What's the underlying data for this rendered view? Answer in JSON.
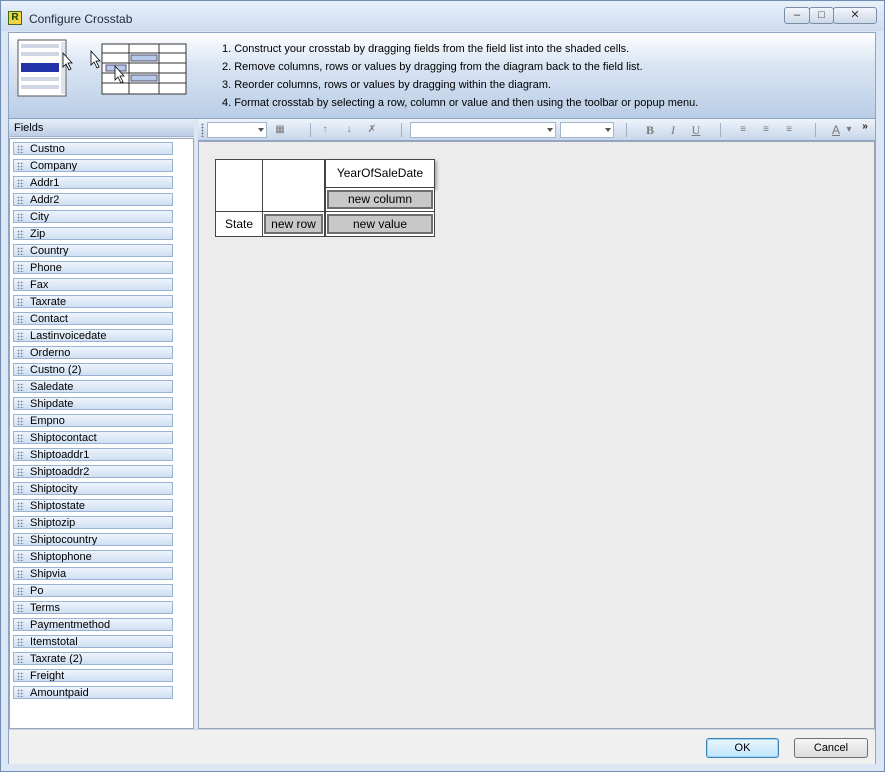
{
  "window": {
    "title": "Configure Crosstab",
    "app_icon_letter": "R"
  },
  "instructions": [
    "1. Construct your crosstab by dragging fields from the field list into the shaded cells.",
    "2. Remove columns, rows or values by dragging from the diagram back to the field list.",
    "3. Reorder columns, rows or values by dragging within the diagram.",
    "4. Format crosstab by selecting a row, column or value and then using the toolbar or popup menu."
  ],
  "fields_panel": {
    "title": "Fields",
    "items": [
      "Custno",
      "Company",
      "Addr1",
      "Addr2",
      "City",
      "Zip",
      "Country",
      "Phone",
      "Fax",
      "Taxrate",
      "Contact",
      "Lastinvoicedate",
      "Orderno",
      "Custno (2)",
      "Saledate",
      "Shipdate",
      "Empno",
      "Shiptocontact",
      "Shiptoaddr1",
      "Shiptoaddr2",
      "Shiptocity",
      "Shiptostate",
      "Shiptozip",
      "Shiptocountry",
      "Shiptophone",
      "Shipvia",
      "Po",
      "Terms",
      "Paymentmethod",
      "Itemstotal",
      "Taxrate (2)",
      "Freight",
      "Amountpaid"
    ]
  },
  "toolbar": {
    "icons": [
      "cell-properties-icon",
      "sort-ascending-icon",
      "sort-descending-icon",
      "clear-sort-icon",
      "bold-icon",
      "italic-icon",
      "underline-icon",
      "align-left-icon",
      "align-center-icon",
      "align-right-icon",
      "font-color-icon",
      "overflow-chevron-icon"
    ],
    "glyphs": {
      "bold": "B",
      "italic": "I",
      "underline": "U",
      "font_color": "A",
      "overflow": "»"
    }
  },
  "crosstab": {
    "column_field": "YearOfSaleDate",
    "new_column": "new column",
    "row_field": "State",
    "new_row": "new row",
    "new_value": "new value"
  },
  "buttons": {
    "ok": "OK",
    "cancel": "Cancel"
  },
  "colors": {
    "header_gradient_end": "#b9cde6",
    "field_item": "#cfdff2",
    "shaded_cell": "#c8c8c8"
  }
}
